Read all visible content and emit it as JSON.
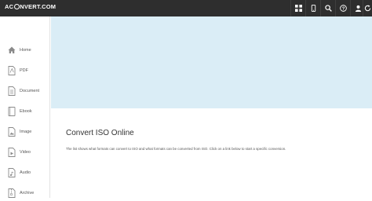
{
  "brand": {
    "logo_text_left": "AC",
    "logo_text_right": "NVERT.COM"
  },
  "topbar": {
    "icons": [
      "grid-icon",
      "mobile-icon",
      "search-icon",
      "help-icon",
      "user-icon",
      "refresh-icon"
    ]
  },
  "sidebar": {
    "items": [
      {
        "label": "Home",
        "icon": "home-icon"
      },
      {
        "label": "PDF",
        "icon": "pdf-icon"
      },
      {
        "label": "Document",
        "icon": "document-icon"
      },
      {
        "label": "Ebook",
        "icon": "ebook-icon"
      },
      {
        "label": "Image",
        "icon": "image-icon"
      },
      {
        "label": "Video",
        "icon": "video-icon"
      },
      {
        "label": "Audio",
        "icon": "audio-icon"
      },
      {
        "label": "Archive",
        "icon": "archive-icon"
      }
    ]
  },
  "main": {
    "title": "Convert ISO Online",
    "description": "The list shows what formats can convert to ISO and what formats can be converted from ISO. Click on a link below to start a specific conversion."
  },
  "colors": {
    "topbar": "#2e2e2e",
    "hero": "#daedf6",
    "sidebar_icon": "#8a8a8a"
  }
}
